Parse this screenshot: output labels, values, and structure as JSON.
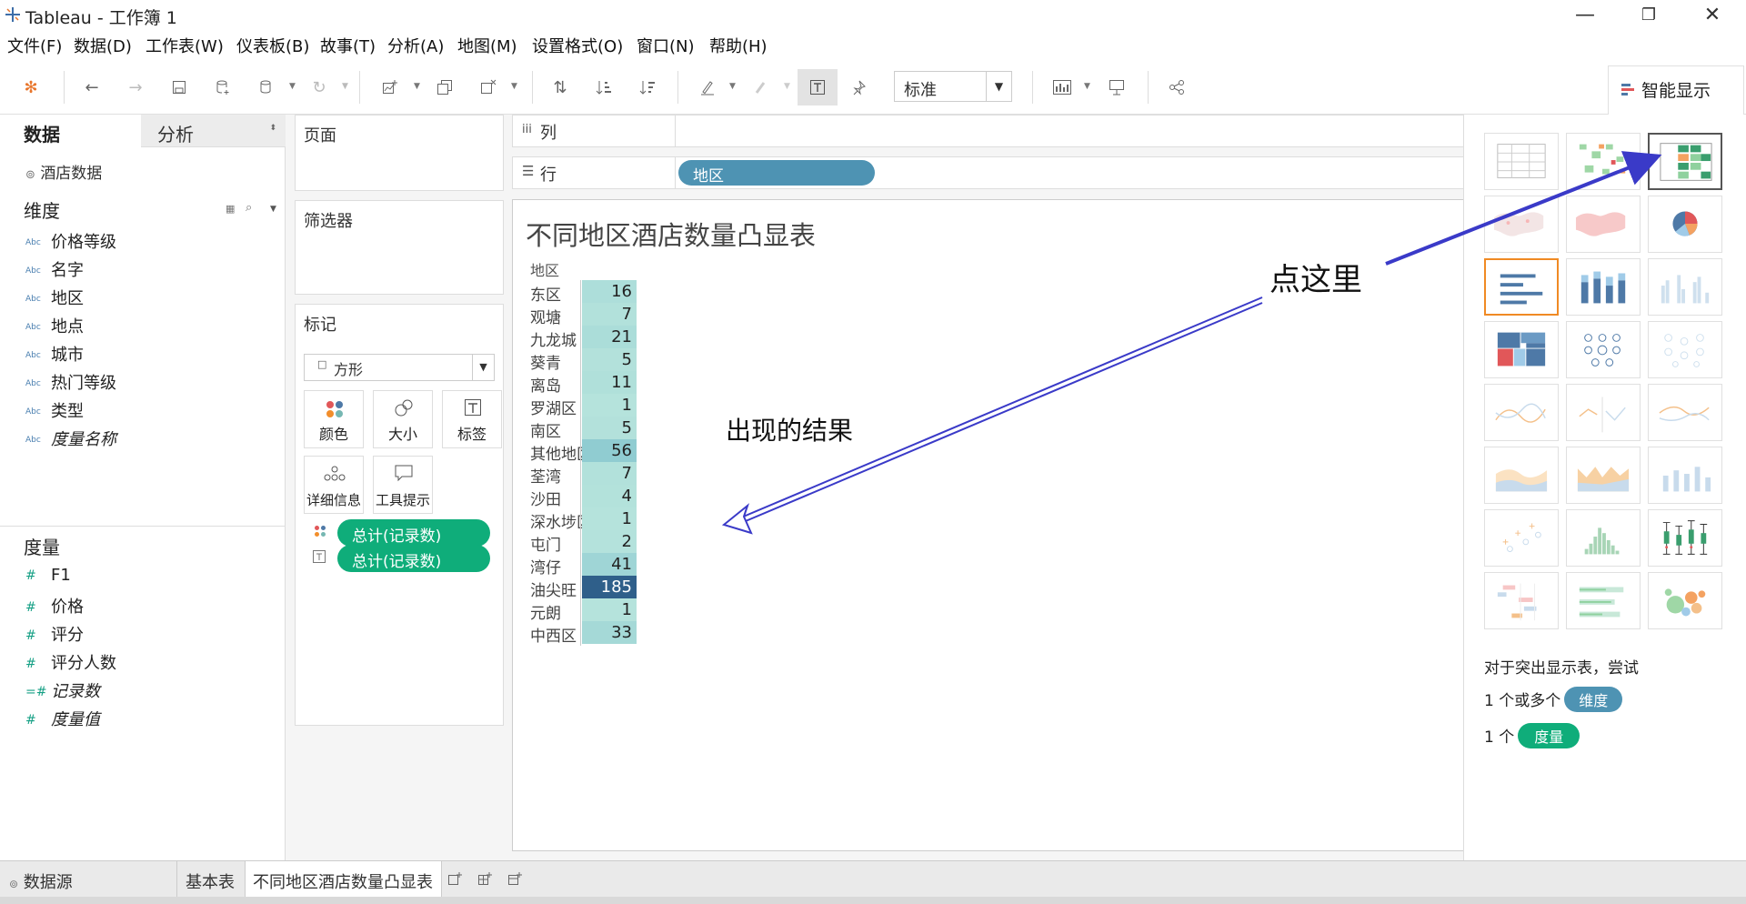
{
  "app": {
    "title": "Tableau - 工作簿 1",
    "window_controls": [
      "—",
      "❐",
      "✕"
    ]
  },
  "menu": [
    "文件(F)",
    "数据(D)",
    "工作表(W)",
    "仪表板(B)",
    "故事(T)",
    "分析(A)",
    "地图(M)",
    "设置格式(O)",
    "窗口(N)",
    "帮助(H)"
  ],
  "toolbar": {
    "fit_value": "标准",
    "show_me_label": "智能显示"
  },
  "data_pane": {
    "tab_data": "数据",
    "tab_analysis": "分析",
    "datasource": "酒店数据",
    "dimensions_title": "维度",
    "dimensions": [
      {
        "type": "Abc",
        "name": "价格等级",
        "italic": false
      },
      {
        "type": "Abc",
        "name": "名字",
        "italic": false
      },
      {
        "type": "Abc",
        "name": "地区",
        "italic": false
      },
      {
        "type": "Abc",
        "name": "地点",
        "italic": false
      },
      {
        "type": "Abc",
        "name": "城市",
        "italic": false
      },
      {
        "type": "Abc",
        "name": "热门等级",
        "italic": false
      },
      {
        "type": "Abc",
        "name": "类型",
        "italic": false
      },
      {
        "type": "Abc",
        "name": "度量名称",
        "italic": true
      }
    ],
    "measures_title": "度量",
    "measures": [
      {
        "type": "#",
        "name": "F1",
        "italic": false
      },
      {
        "type": "#",
        "name": "价格",
        "italic": false
      },
      {
        "type": "#",
        "name": "评分",
        "italic": false
      },
      {
        "type": "#",
        "name": "评分人数",
        "italic": false
      },
      {
        "type": "=#",
        "name": "记录数",
        "italic": true
      },
      {
        "type": "#",
        "name": "度量值",
        "italic": true
      }
    ]
  },
  "shelves": {
    "pages": "页面",
    "filters": "筛选器",
    "marks": "标记",
    "mark_type": "方形",
    "mark_buttons": [
      "颜色",
      "大小",
      "标签",
      "详细信息",
      "工具提示"
    ],
    "mark_pills": [
      "总计(记录数)",
      "总计(记录数)"
    ],
    "columns_label": "列",
    "rows_label": "行",
    "rows_pill": "地区"
  },
  "view": {
    "title": "不同地区酒店数量凸显表",
    "header": "地区",
    "rows": [
      {
        "region": "东区",
        "count": "16"
      },
      {
        "region": "观塘",
        "count": "7"
      },
      {
        "region": "九龙城",
        "count": "21"
      },
      {
        "region": "葵青",
        "count": "5"
      },
      {
        "region": "离岛",
        "count": "11"
      },
      {
        "region": "罗湖区",
        "count": "1"
      },
      {
        "region": "南区",
        "count": "5"
      },
      {
        "region": "其他地区",
        "count": "56"
      },
      {
        "region": "荃湾",
        "count": "7"
      },
      {
        "region": "沙田",
        "count": "4"
      },
      {
        "region": "深水埗区",
        "count": "1"
      },
      {
        "region": "屯门",
        "count": "2"
      },
      {
        "region": "湾仔",
        "count": "41"
      },
      {
        "region": "油尖旺",
        "count": "185"
      },
      {
        "region": "元朗",
        "count": "1"
      },
      {
        "region": "中西区",
        "count": "33"
      }
    ],
    "annotation_click": "点这里",
    "annotation_result": "出现的结果"
  },
  "show_me": {
    "hint_title": "对于突出显示表，尝试",
    "hint_dims_prefix": "1 个或多个",
    "hint_dims_pill": "维度",
    "hint_meas_prefix": "1 个",
    "hint_meas_pill": "度量"
  },
  "bottom_tabs": {
    "datasource": "数据源",
    "sheet1": "基本表",
    "sheet2": "不同地区酒店数量凸显表"
  },
  "colors": {
    "accent_green": "#0fad7a",
    "pill_blue": "#4e93b3",
    "heat_low": "#b5e3dc",
    "heat_mid": "#6bb6c7",
    "heat_high": "#2f5f8a",
    "arrow": "#3a3ac8"
  }
}
